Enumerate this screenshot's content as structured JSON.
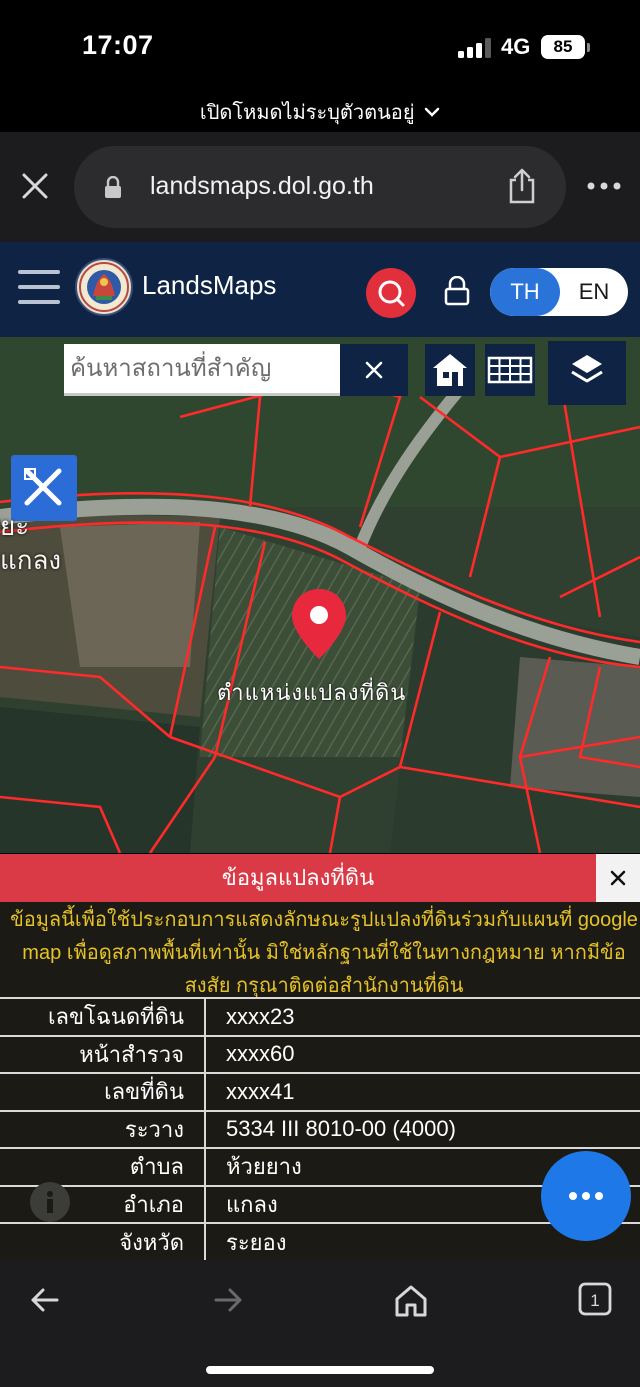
{
  "status_bar": {
    "time": "17:07",
    "network": "4G",
    "battery": "85"
  },
  "private_mode_text": "เปิดโหมดไม่ระบุตัวตนอยู่",
  "browser": {
    "url": "landsmaps.dol.go.th"
  },
  "site": {
    "brand": "LandsMaps",
    "lang_th": "TH",
    "lang_en": "EN"
  },
  "map": {
    "search_placeholder": "ค้นหาสถานที่สำคัญ",
    "side_label_line1": "ยะ",
    "side_label_line2": "แกลง",
    "parcel_label": "ตำแหน่งแปลงที่ดิน"
  },
  "panel": {
    "title": "ข้อมูลแปลงที่ดิน",
    "notice": "ข้อมูลนี้เพื่อใช้ประกอบการแสดงลักษณะรูปแปลงที่ดินร่วมกับแผนที่ google map เพื่อดูสภาพพื้นที่เท่านั้น มิใช่หลักฐานที่ใช้ในทางกฎหมาย หากมีข้อสงสัย กรุณาติดต่อสำนักงานที่ดิน",
    "rows": [
      {
        "key": "เลขโฉนดที่ดิน",
        "value": "xxxx23"
      },
      {
        "key": "หน้าสำรวจ",
        "value": "xxxx60"
      },
      {
        "key": "เลขที่ดิน",
        "value": "xxxx41"
      },
      {
        "key": "ระวาง",
        "value": "5334 III 8010-00 (4000)"
      },
      {
        "key": "ตำบล",
        "value": "ห้วยยาง"
      },
      {
        "key": "อำเภอ",
        "value": "แกลง"
      },
      {
        "key": "จังหวัด",
        "value": "ระยอง"
      }
    ]
  },
  "bottom_toolbar": {
    "tab_count": "1"
  },
  "colors": {
    "header_bg": "#0f2444",
    "accent_red": "#d93a46",
    "accent_blue": "#2a73d9",
    "notice_text": "#e6c22a"
  }
}
